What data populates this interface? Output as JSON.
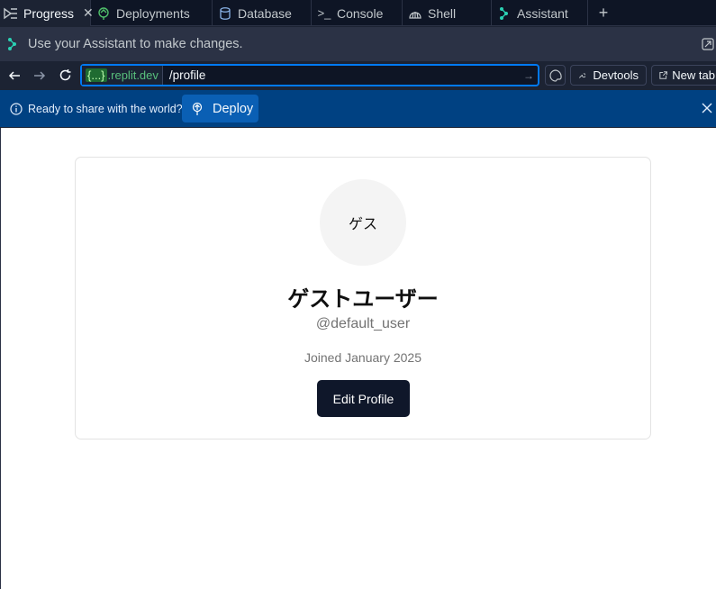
{
  "tabs": [
    {
      "label": "Progress",
      "icon": "progress-icon",
      "active": true,
      "closable": true
    },
    {
      "label": "Deployments",
      "icon": "deployments-icon"
    },
    {
      "label": "Database",
      "icon": "database-icon"
    },
    {
      "label": "Console",
      "icon": "console-icon"
    },
    {
      "label": "Shell",
      "icon": "shell-icon"
    },
    {
      "label": "Assistant",
      "icon": "assistant-icon"
    }
  ],
  "tab_close_glyph": "✕",
  "tab_add_glyph": "+",
  "assistant_bar": {
    "text": "Use your Assistant to make changes."
  },
  "address": {
    "domain_dots": "{...}",
    "domain_suffix": ".replit.dev",
    "path": "/profile",
    "devtools_label": "Devtools",
    "new_tab_label": "New tab"
  },
  "banner": {
    "message": "Ready to share with the world?",
    "deploy_label": "Deploy"
  },
  "profile": {
    "avatar_text": "ゲス",
    "name": "ゲストユーザー",
    "handle": "@default_user",
    "joined": "Joined January 2025",
    "edit_label": "Edit Profile"
  },
  "colors": {
    "accent": "#0079f2",
    "banner_bg": "#004182",
    "button_dark": "#0f172a",
    "domain_green": "#58c07c"
  }
}
